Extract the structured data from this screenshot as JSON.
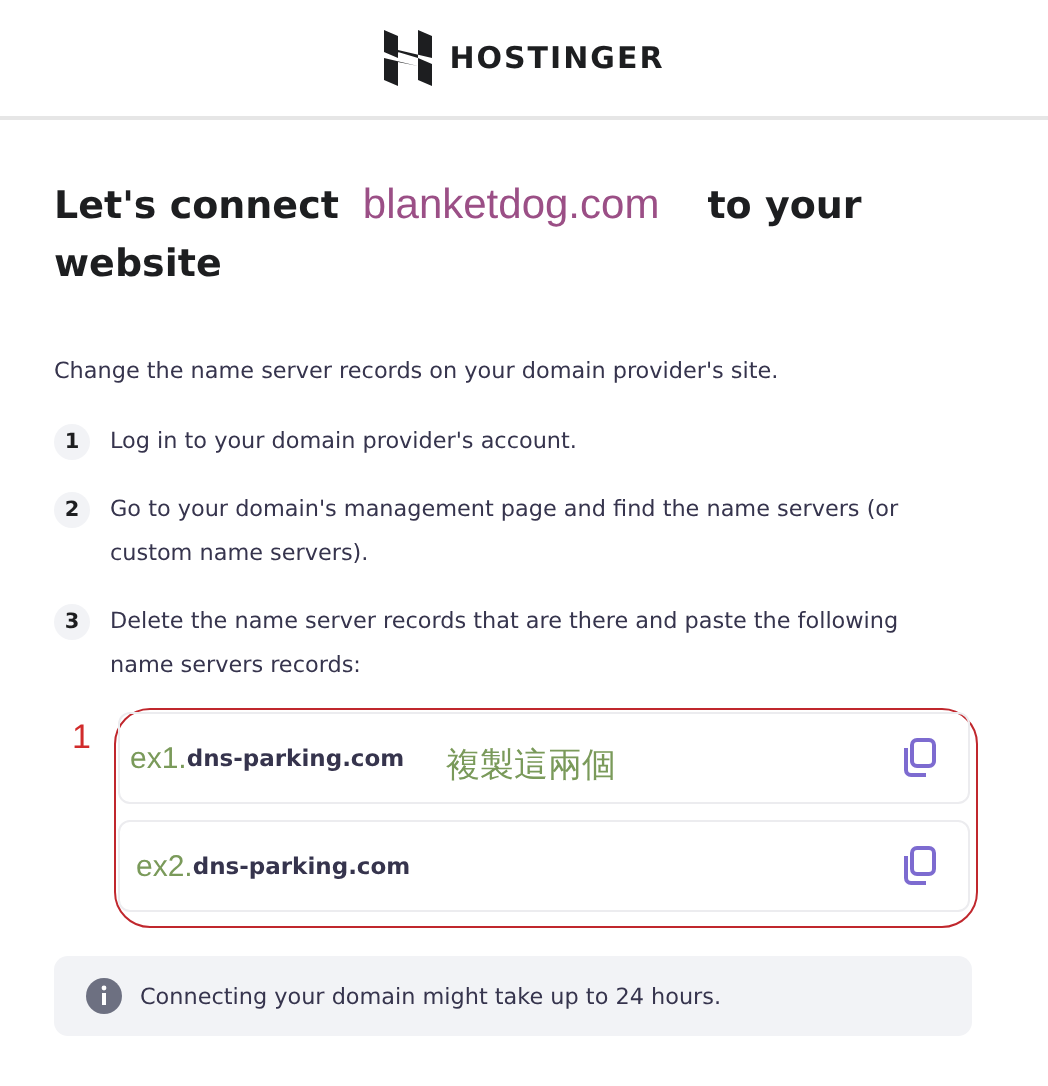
{
  "header": {
    "brand": "HOSTINGER"
  },
  "title": {
    "lead": "Let's connect",
    "domain": "blanketdog.com",
    "tail": "to your",
    "line2": "website"
  },
  "intro": "Change the name server records on your domain provider's site.",
  "steps": [
    {
      "number": "1",
      "text": "Log in to your domain provider's account."
    },
    {
      "number": "2",
      "text": "Go to your domain's management page and find the name servers (or custom name servers)."
    },
    {
      "number": "3",
      "text": "Delete the name server records that are there and paste the following name servers records:"
    }
  ],
  "annotation": {
    "marker": "1",
    "note": "複製這兩個"
  },
  "records": [
    {
      "prefix": "ex1.",
      "value": "dns-parking.com"
    },
    {
      "prefix": "ex2.",
      "value": "dns-parking.com"
    }
  ],
  "info": "Connecting your domain might take up to 24 hours."
}
